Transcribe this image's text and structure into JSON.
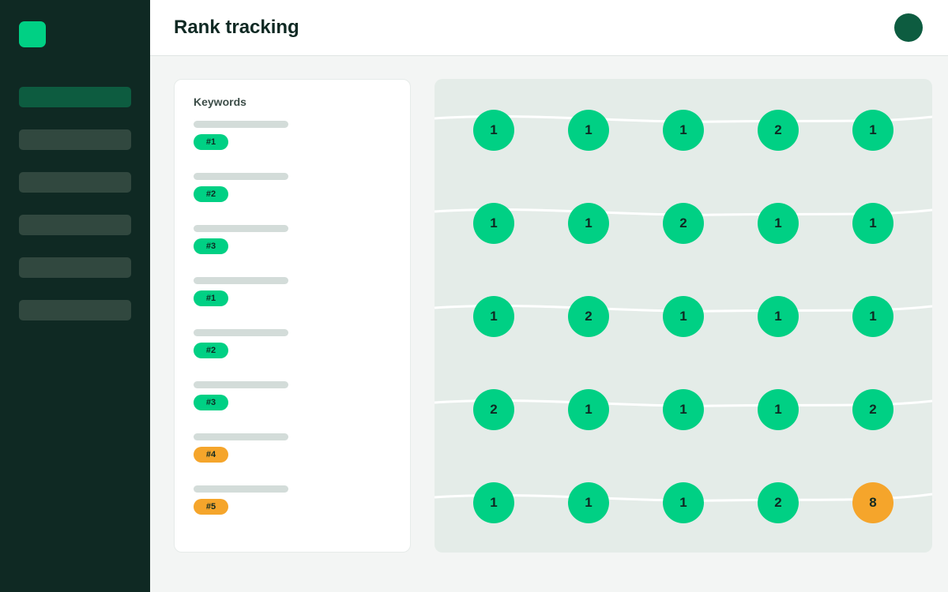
{
  "header": {
    "title": "Rank tracking"
  },
  "colors": {
    "sidebar_bg": "#0f2923",
    "brand_green": "#00d084",
    "nav_active": "#0d5c40",
    "nav_inactive": "#31483f",
    "avatar": "#0d5c40",
    "rank_good": "#00d084",
    "rank_warn": "#f5a52b",
    "map_bg": "#e4ece8"
  },
  "sidebar": {
    "logo_icon": "app-logo-square",
    "active_index": 0,
    "item_count": 6
  },
  "keywords_panel": {
    "title": "Keywords",
    "items": [
      {
        "badge": "#1",
        "status": "good"
      },
      {
        "badge": "#2",
        "status": "good"
      },
      {
        "badge": "#3",
        "status": "good"
      },
      {
        "badge": "#1",
        "status": "good"
      },
      {
        "badge": "#2",
        "status": "good"
      },
      {
        "badge": "#3",
        "status": "good"
      },
      {
        "badge": "#4",
        "status": "warn"
      },
      {
        "badge": "#5",
        "status": "warn"
      }
    ]
  },
  "rank_grid": {
    "rows": [
      [
        "1",
        "1",
        "1",
        "2",
        "1"
      ],
      [
        "1",
        "1",
        "2",
        "1",
        "1"
      ],
      [
        "1",
        "2",
        "1",
        "1",
        "1"
      ],
      [
        "2",
        "1",
        "1",
        "1",
        "2"
      ],
      [
        "1",
        "1",
        "1",
        "2",
        "8"
      ]
    ],
    "warn_threshold": 4
  }
}
